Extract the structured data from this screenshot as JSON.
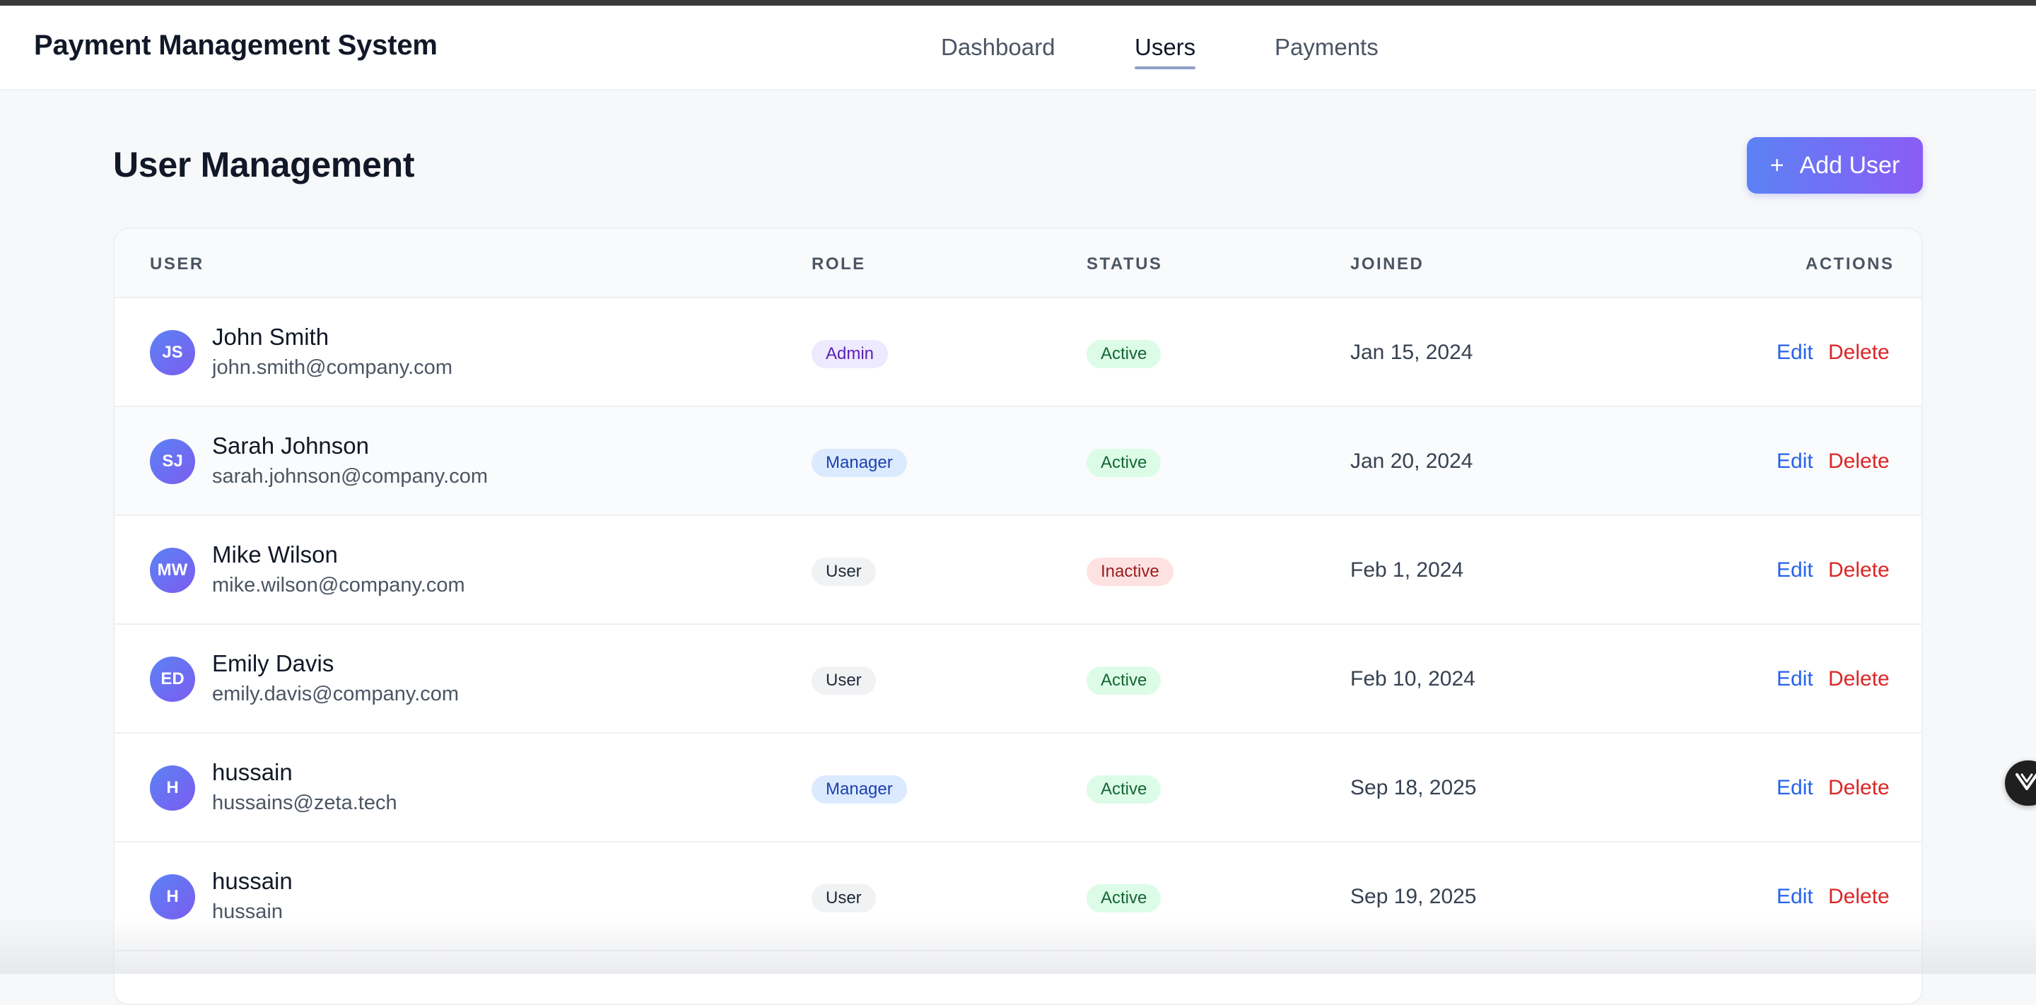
{
  "app": {
    "title": "Payment Management System"
  },
  "nav": [
    {
      "label": "Dashboard",
      "active": false
    },
    {
      "label": "Users",
      "active": true
    },
    {
      "label": "Payments",
      "active": false
    }
  ],
  "page": {
    "title": "User Management",
    "add_button": "Add User",
    "add_icon": "plus-icon"
  },
  "table": {
    "headers": {
      "user": "USER",
      "role": "ROLE",
      "status": "STATUS",
      "joined": "JOINED",
      "actions": "ACTIONS"
    },
    "action_labels": {
      "edit": "Edit",
      "delete": "Delete"
    },
    "rows": [
      {
        "initials": "JS",
        "name": "John Smith",
        "email": "john.smith@company.com",
        "role": "Admin",
        "status": "Active",
        "joined": "Jan 15, 2024"
      },
      {
        "initials": "SJ",
        "name": "Sarah Johnson",
        "email": "sarah.johnson@company.com",
        "role": "Manager",
        "status": "Active",
        "joined": "Jan 20, 2024"
      },
      {
        "initials": "MW",
        "name": "Mike Wilson",
        "email": "mike.wilson@company.com",
        "role": "User",
        "status": "Inactive",
        "joined": "Feb 1, 2024"
      },
      {
        "initials": "ED",
        "name": "Emily Davis",
        "email": "emily.davis@company.com",
        "role": "User",
        "status": "Active",
        "joined": "Feb 10, 2024"
      },
      {
        "initials": "H",
        "name": "hussain",
        "email": "hussains@zeta.tech",
        "role": "Manager",
        "status": "Active",
        "joined": "Sep 18, 2025"
      },
      {
        "initials": "H",
        "name": "hussain",
        "email": "hussain",
        "role": "User",
        "status": "Active",
        "joined": "Sep 19, 2025"
      }
    ]
  },
  "colors": {
    "accent_gradient_start": "#5b82f4",
    "accent_gradient_end": "#8b5cf6",
    "edit_link": "#2563eb",
    "delete_link": "#dc2626"
  },
  "floating_widget": {
    "icon": "chevron-v-icon"
  }
}
